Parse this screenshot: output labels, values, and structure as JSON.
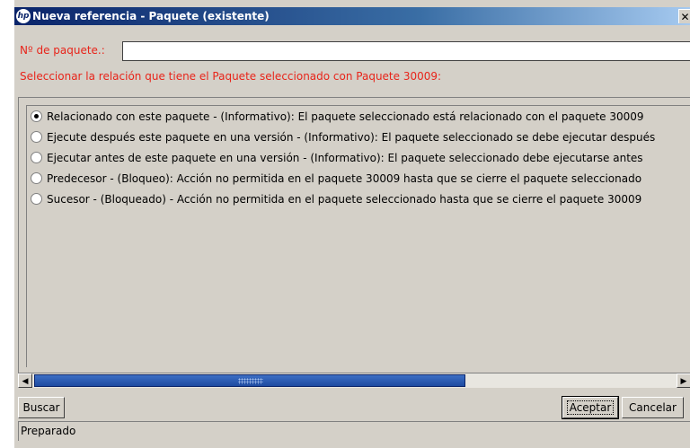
{
  "window": {
    "title": "Nueva referencia - Paquete (existente)",
    "logo_text": "hp",
    "close_glyph": "✕"
  },
  "package_field": {
    "label": "Nº de paquete.:",
    "value": ""
  },
  "relation_prompt": "Seleccionar la relación que tiene el Paquete seleccionado con Paquete 30009:",
  "relations": [
    {
      "label": "Relacionado con este paquete - (Informativo): El paquete seleccionado está relacionado con el paquete 30009",
      "selected": true
    },
    {
      "label": "Ejecute después este paquete en una versión - (Informativo): El paquete seleccionado se debe ejecutar después",
      "selected": false
    },
    {
      "label": "Ejecutar antes de este paquete en una versión - (Informativo): El paquete seleccionado debe ejecutarse antes",
      "selected": false
    },
    {
      "label": "Predecesor - (Bloqueo): Acción no permitida en el paquete 30009 hasta que se cierre el paquete seleccionado",
      "selected": false
    },
    {
      "label": "Sucesor - (Bloqueado) - Acción no permitida en el paquete seleccionado hasta que se cierre el paquete 30009",
      "selected": false
    }
  ],
  "scrollbar": {
    "left_arrow": "◀",
    "right_arrow": "▶",
    "position_fraction": 0
  },
  "buttons": {
    "search": "Buscar",
    "accept": "Aceptar",
    "cancel": "Cancelar"
  },
  "status": "Preparado",
  "colors": {
    "accent_text": "#e8241a",
    "title_bar": "#0a246a",
    "face": "#d4d0c8"
  }
}
